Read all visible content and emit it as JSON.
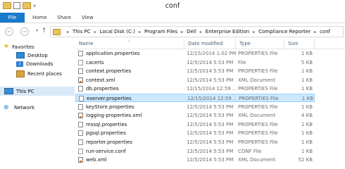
{
  "window": {
    "title": "conf"
  },
  "ribbon": {
    "tabs": [
      "File",
      "Home",
      "Share",
      "View"
    ]
  },
  "address": {
    "crumbs": [
      "This PC",
      "Local Disk (C:)",
      "Program Files",
      "Dell",
      "Enterprise Edition",
      "Compliance Reporter",
      "conf"
    ]
  },
  "nav": {
    "favorites": "Favorites",
    "desktop": "Desktop",
    "downloads": "Downloads",
    "recent": "Recent places",
    "thispc": "This PC",
    "network": "Network"
  },
  "columns": {
    "name": "Name",
    "date": "Date modified",
    "type": "Type",
    "size": "Size"
  },
  "files": [
    {
      "name": "application.properties",
      "date": "12/15/2014 1:02 PM",
      "type": "PROPERTIES File",
      "size": "1 KB",
      "icon": "properties-file-icon"
    },
    {
      "name": "cacerts",
      "date": "12/5/2014 5:53 PM",
      "type": "File",
      "size": "5 KB",
      "icon": "generic-file-icon"
    },
    {
      "name": "context.properties",
      "date": "12/5/2014 5:53 PM",
      "type": "PROPERTIES File",
      "size": "1 KB",
      "icon": "properties-file-icon"
    },
    {
      "name": "context.xml",
      "date": "12/5/2014 5:53 PM",
      "type": "XML Document",
      "size": "1 KB",
      "icon": "xml-file-icon"
    },
    {
      "name": "db.properties",
      "date": "12/15/2014 12:59 ...",
      "type": "PROPERTIES File",
      "size": "1 KB",
      "icon": "properties-file-icon"
    },
    {
      "name": "eserver.properties",
      "date": "12/15/2014 12:59 ...",
      "type": "PROPERTIES File",
      "size": "1 KB",
      "icon": "properties-file-icon",
      "selected": true
    },
    {
      "name": "keyStore.properties",
      "date": "12/5/2014 5:53 PM",
      "type": "PROPERTIES File",
      "size": "1 KB",
      "icon": "properties-file-icon"
    },
    {
      "name": "logging-properties.xml",
      "date": "12/5/2014 5:53 PM",
      "type": "XML Document",
      "size": "4 KB",
      "icon": "xml-file-icon"
    },
    {
      "name": "mssql.properties",
      "date": "12/5/2014 5:53 PM",
      "type": "PROPERTIES File",
      "size": "1 KB",
      "icon": "properties-file-icon"
    },
    {
      "name": "pgsql.properties",
      "date": "12/5/2014 5:53 PM",
      "type": "PROPERTIES File",
      "size": "1 KB",
      "icon": "properties-file-icon"
    },
    {
      "name": "reporter.properties",
      "date": "12/5/2014 5:53 PM",
      "type": "PROPERTIES File",
      "size": "1 KB",
      "icon": "properties-file-icon"
    },
    {
      "name": "run-service.conf",
      "date": "12/5/2014 5:53 PM",
      "type": "CONF File",
      "size": "1 KB",
      "icon": "conf-file-icon"
    },
    {
      "name": "web.xml",
      "date": "12/5/2014 5:53 PM",
      "type": "XML Document",
      "size": "52 KB",
      "icon": "xml-file-icon"
    }
  ],
  "colors": {
    "file_tab": "#1979ca",
    "selection": "#cce8ff",
    "selection_border": "#99d1ff",
    "nav_selected": "#d9e9f8"
  }
}
